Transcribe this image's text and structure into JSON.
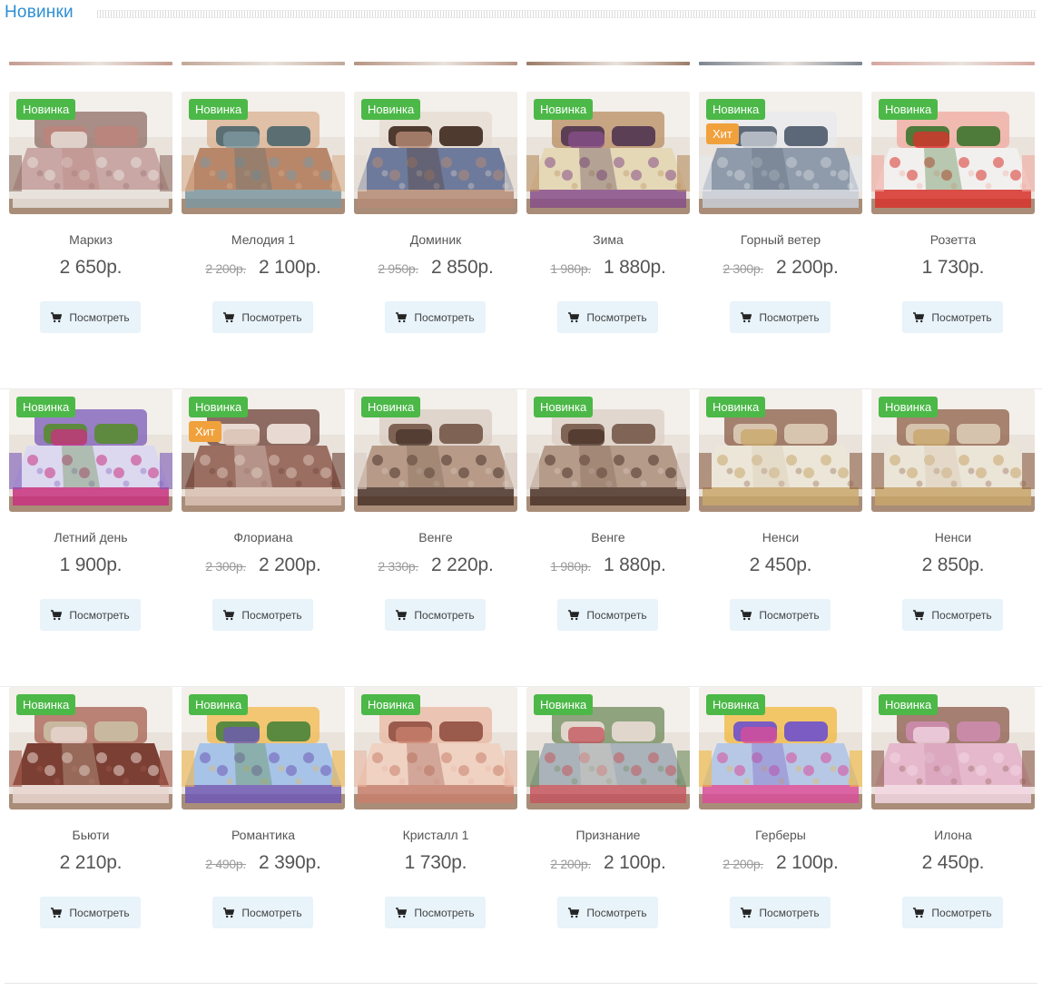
{
  "section": {
    "title": "Новинки"
  },
  "labels": {
    "new": "Новинка",
    "hit": "Хит",
    "view": "Посмотреть"
  },
  "top_strip_colors": [
    "#c49b8f",
    "#c2a998",
    "#b79483",
    "#9c7a66",
    "#7d8590",
    "#d6a7a0"
  ],
  "products": [
    {
      "name": "Маркиз",
      "price": "2 650р.",
      "new": true,
      "hit": false,
      "colors": [
        "#c9a7a5",
        "#e8e2dc",
        "#8f6e66",
        "#b9857c"
      ]
    },
    {
      "name": "Мелодия 1",
      "old_price": "2 200р.",
      "price": "2 100р.",
      "new": true,
      "hit": false,
      "colors": [
        "#b8876a",
        "#7e98a0",
        "#d9b08f",
        "#5b6f73"
      ]
    },
    {
      "name": "Доминик",
      "old_price": "2 950р.",
      "price": "2 850р.",
      "new": true,
      "hit": false,
      "colors": [
        "#6d7a9c",
        "#b58b75",
        "#e5dbd1",
        "#4f3a2f"
      ]
    },
    {
      "name": "Зима",
      "old_price": "1 980р.",
      "price": "1 880р.",
      "new": true,
      "hit": false,
      "colors": [
        "#e4d8b6",
        "#874f88",
        "#b88c5f",
        "#5b3f55"
      ]
    },
    {
      "name": "Горный ветер",
      "old_price": "2 300р.",
      "price": "2 200р.",
      "new": true,
      "hit": true,
      "colors": [
        "#8f9bab",
        "#c9ced6",
        "#e8eaee",
        "#5c6777"
      ]
    },
    {
      "name": "Розетта",
      "price": "1 730р.",
      "new": true,
      "hit": false,
      "colors": [
        "#f2f0ee",
        "#d8332c",
        "#f0a89e",
        "#4e7a3a"
      ]
    },
    {
      "name": "Летний день",
      "price": "1 900р.",
      "new": true,
      "hit": false,
      "colors": [
        "#dcd8f0",
        "#c8317f",
        "#7a58b8",
        "#5d8a3e"
      ]
    },
    {
      "name": "Флориана",
      "old_price": "2 300р.",
      "price": "2 200р.",
      "new": true,
      "hit": true,
      "colors": [
        "#9b6e62",
        "#d9c1b4",
        "#6b3f34",
        "#e8dad2"
      ]
    },
    {
      "name": "Венге",
      "old_price": "2 330р.",
      "price": "2 220р.",
      "new": true,
      "hit": false,
      "colors": [
        "#b79b88",
        "#4a3329",
        "#d9ccc1",
        "#7e6354"
      ]
    },
    {
      "name": "Венге",
      "old_price": "1 980р.",
      "price": "1 880р.",
      "new": true,
      "hit": false,
      "colors": [
        "#b59b89",
        "#4b3328",
        "#dccfc6",
        "#806556"
      ]
    },
    {
      "name": "Ненси",
      "price": "2 450р.",
      "new": true,
      "hit": false,
      "colors": [
        "#ece6d8",
        "#c9a86c",
        "#8a5b45",
        "#d8c5b0"
      ]
    },
    {
      "name": "Ненси",
      "price": "2 850р.",
      "new": true,
      "hit": false,
      "colors": [
        "#ebe5d8",
        "#c8a66a",
        "#8c5d46",
        "#d6c3ae"
      ]
    },
    {
      "name": "Бьюти",
      "price": "2 210р.",
      "new": true,
      "hit": false,
      "colors": [
        "#7c3f33",
        "#e9d5cf",
        "#a65d4e",
        "#c9b8a0"
      ]
    },
    {
      "name": "Романтика",
      "old_price": "2 490р.",
      "price": "2 390р.",
      "new": true,
      "hit": false,
      "colors": [
        "#a7c3e8",
        "#6e59b5",
        "#f2b84b",
        "#5a8a3f"
      ]
    },
    {
      "name": "Кристалл 1",
      "price": "1 730р.",
      "new": true,
      "hit": false,
      "colors": [
        "#f0d2c3",
        "#c8806c",
        "#e8b5a0",
        "#9a5a4c"
      ]
    },
    {
      "name": "Признание",
      "old_price": "2 200р.",
      "price": "2 100р.",
      "new": true,
      "hit": false,
      "colors": [
        "#a9b3b9",
        "#c4575f",
        "#6e8a5a",
        "#e1d6cc"
      ]
    },
    {
      "name": "Герберы",
      "old_price": "2 200р.",
      "price": "2 100р.",
      "new": true,
      "hit": false,
      "colors": [
        "#b7c8e6",
        "#d84d9a",
        "#f2b83a",
        "#7a5cc2"
      ]
    },
    {
      "name": "Илона",
      "price": "2 450р.",
      "new": true,
      "hit": false,
      "colors": [
        "#e6b8cc",
        "#f2d6e2",
        "#8a5a4a",
        "#c98aa8"
      ]
    }
  ]
}
